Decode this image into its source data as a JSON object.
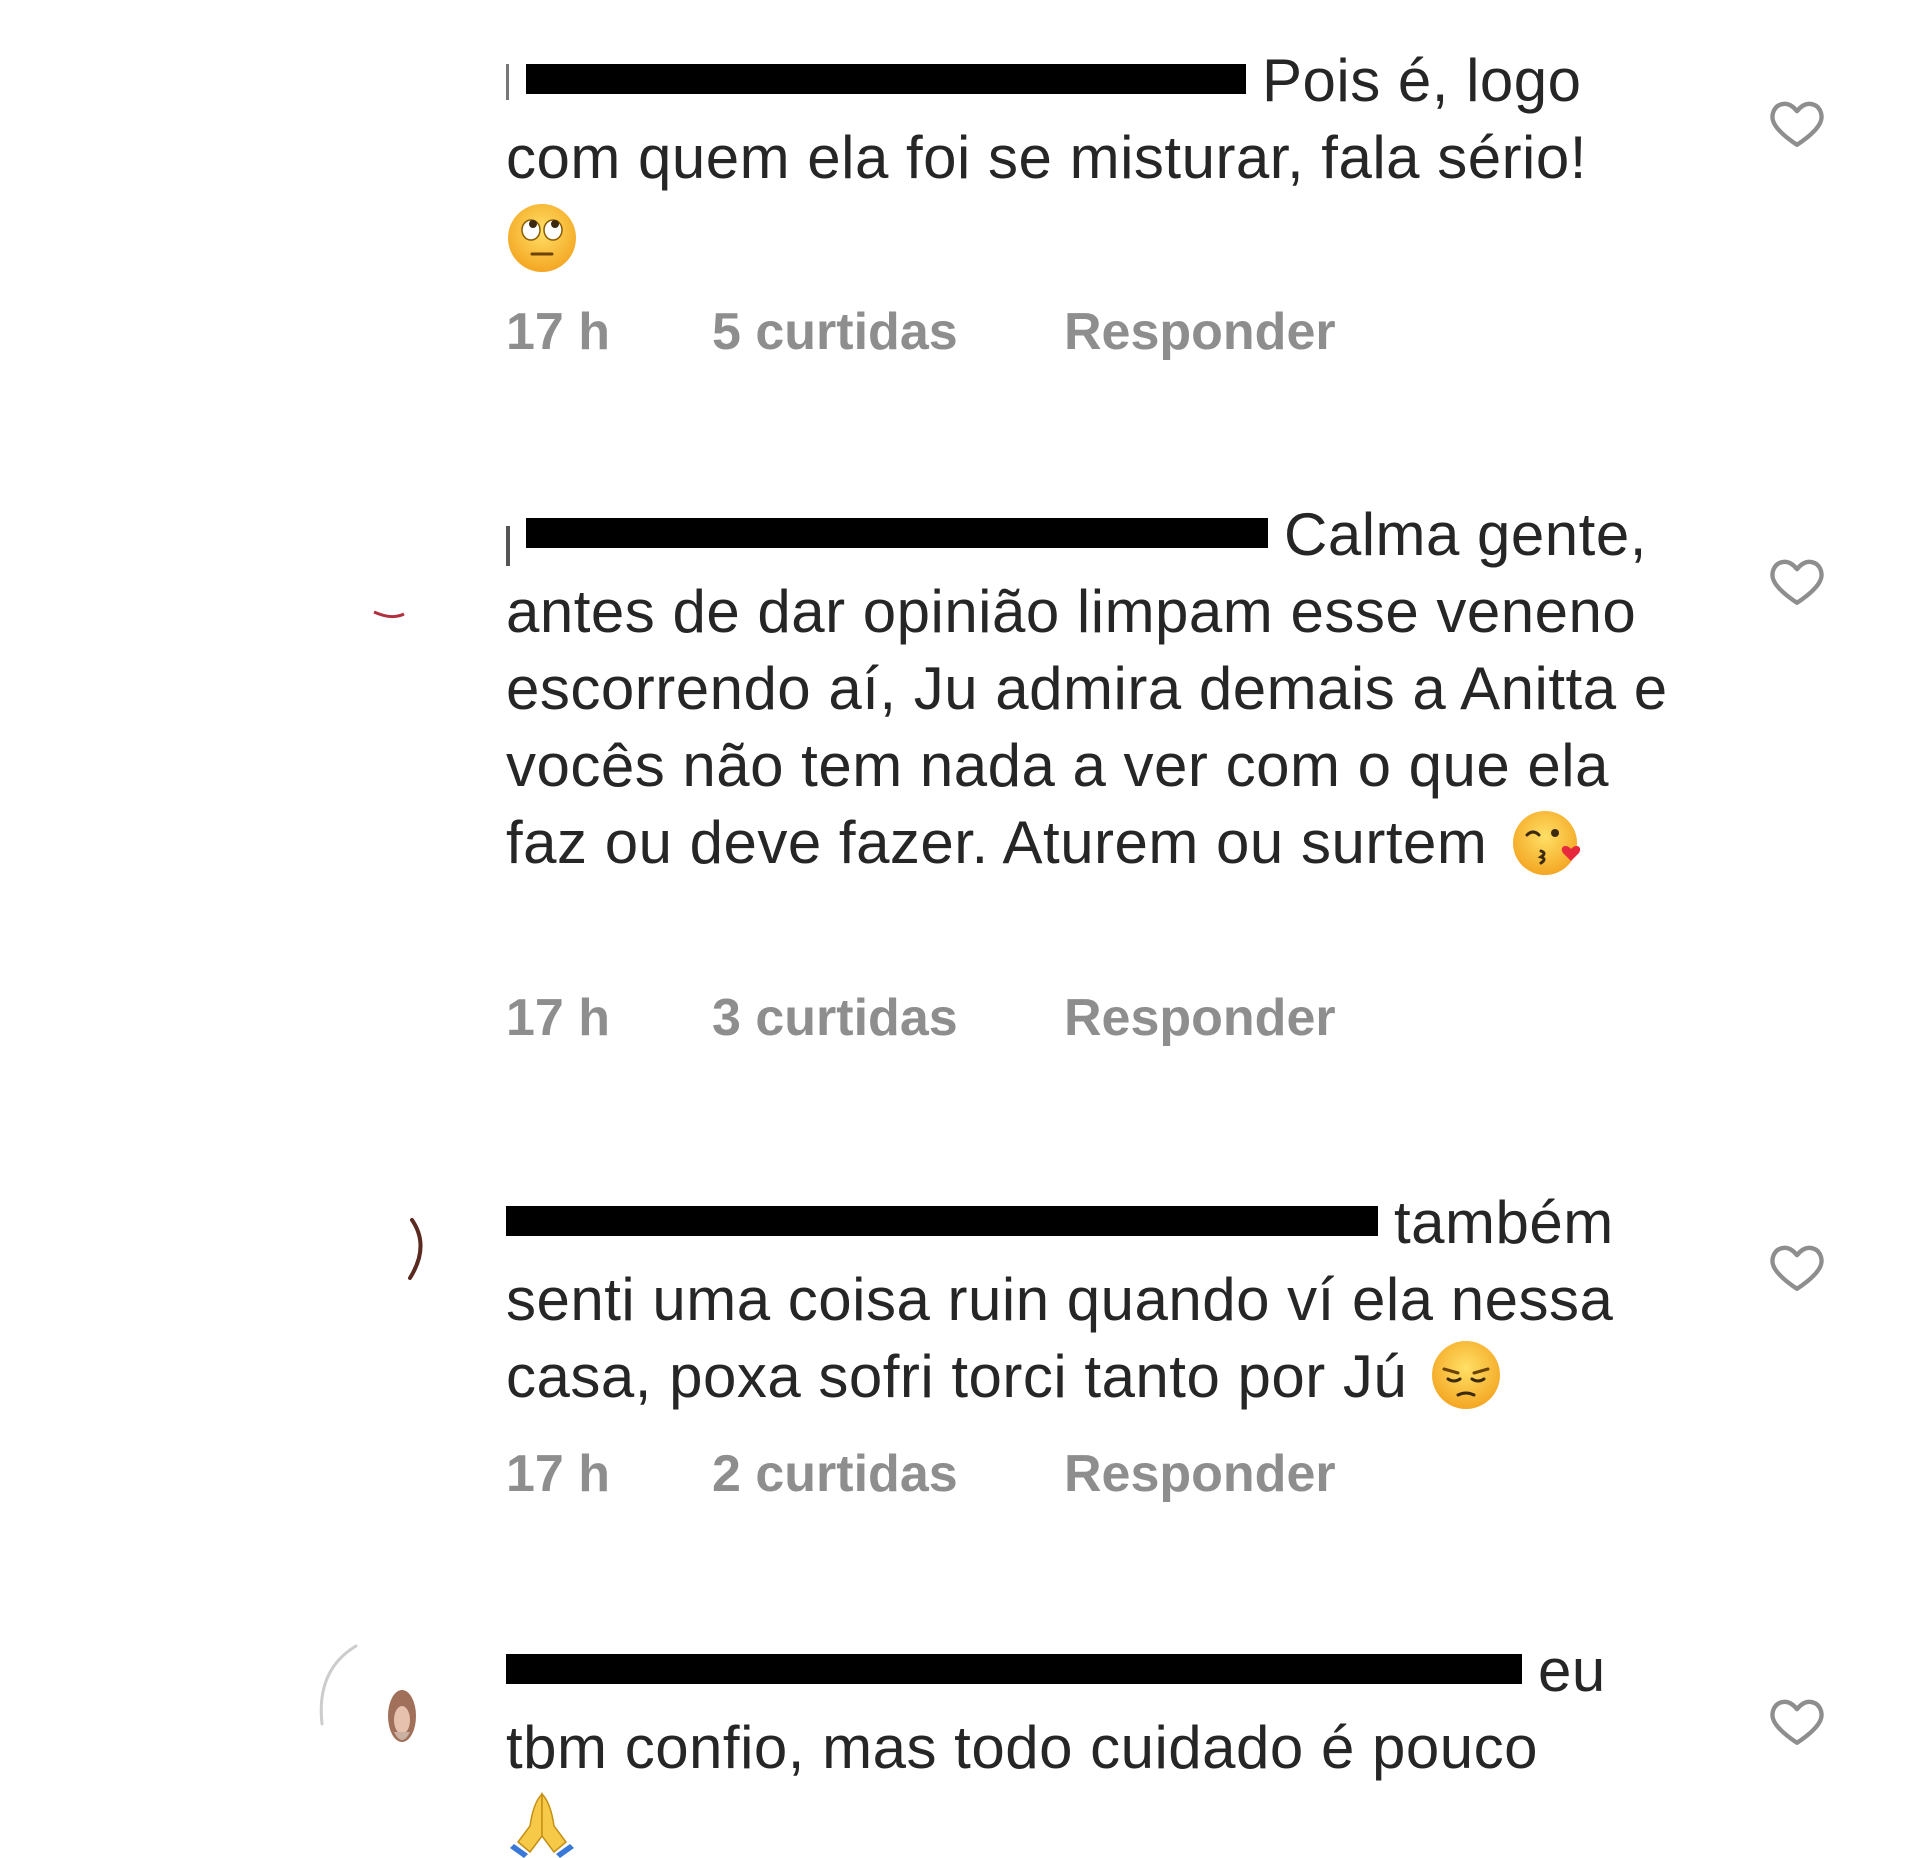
{
  "comments": [
    {
      "text": "Pois é, logo com quem ela foi se misturar, fala sério!",
      "emoji": "eye-roll-emoji",
      "time": "17 h",
      "likes": "5 curtidas",
      "reply": "Responder"
    },
    {
      "text": "Calma gente, antes de dar opinião limpam esse veneno escorrendo aí, Ju admira demais a Anitta e vocês não tem nada a ver com o que ela faz ou deve fazer. Aturem ou surtem",
      "emoji": "kiss-wink-emoji",
      "time": "17 h",
      "likes": "3 curtidas",
      "reply": "Responder"
    },
    {
      "text": "também senti uma coisa ruin quando ví ela nessa casa, poxa sofri torci tanto por Jú",
      "emoji": "pensive-emoji",
      "time": "17 h",
      "likes": "2 curtidas",
      "reply": "Responder"
    },
    {
      "text": "eu tbm confio, mas todo cuidado é pouco",
      "emoji": "folded-hands-emoji"
    }
  ],
  "colors": {
    "text": "#262626",
    "meta": "#8e8e8e",
    "redaction": "#000000",
    "heart": "#8e8e8e"
  }
}
